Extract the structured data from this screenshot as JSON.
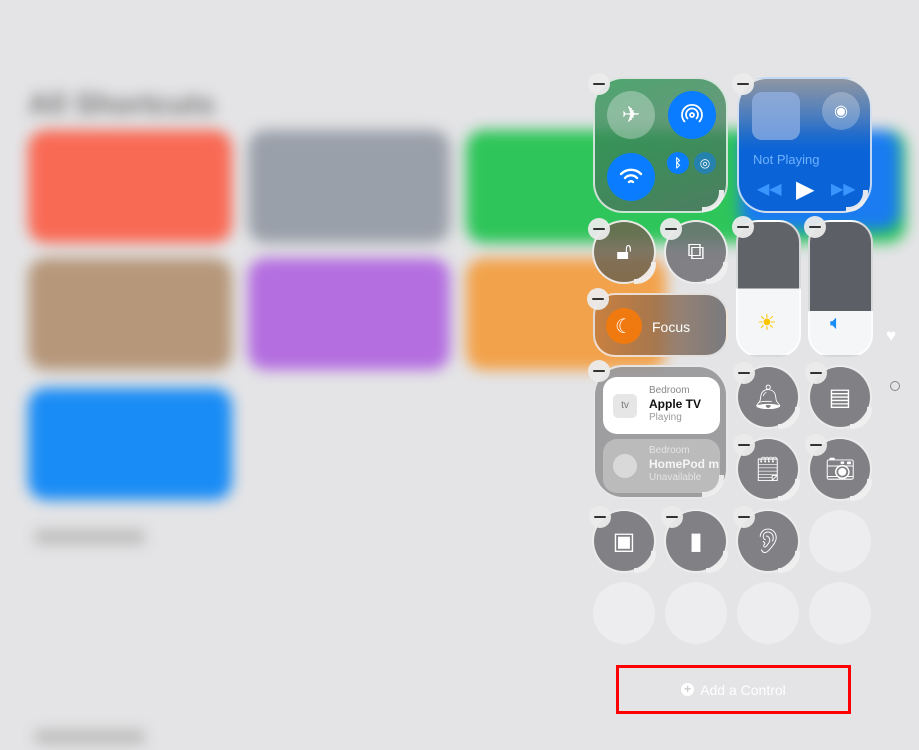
{
  "background": {
    "title": "All Shortcuts",
    "tile_colors": [
      "#f96a55",
      "#9aa0aa",
      "#2ec55a",
      "#b6977a",
      "#b46ee0",
      "#f2a24a",
      "#1a8cf5"
    ]
  },
  "connectivity": {
    "airplane": "airplane-icon",
    "airdrop": "airdrop-icon",
    "wifi": "wifi-icon",
    "bluetooth": "bluetooth-icon",
    "cellular": "cellular-icon"
  },
  "media": {
    "status": "Not Playing"
  },
  "focus": {
    "label": "Focus"
  },
  "home": {
    "devices": [
      {
        "room": "Bedroom",
        "name": "Apple TV",
        "status": "Playing",
        "icon_text": "tv"
      },
      {
        "room": "Bedroom",
        "name": "HomePod m",
        "status": "Unavailable"
      }
    ]
  },
  "add_control": {
    "label": "Add a Control"
  },
  "colors": {
    "accent": "#0a7cff",
    "focus": "#f07a10",
    "highlight": "#ff0000"
  }
}
